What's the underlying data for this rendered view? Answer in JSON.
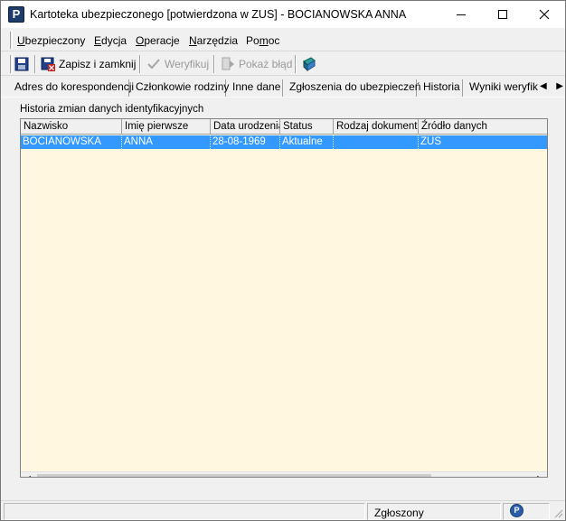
{
  "window": {
    "title": "Kartoteka ubezpieczonego [potwierdzona w ZUS] - BOCIANOWSKA ANNA",
    "app_icon_letter": "P"
  },
  "menu": {
    "items": [
      {
        "label": "Ubezpieczony",
        "accel": "U"
      },
      {
        "label": "Edycja",
        "accel": "E"
      },
      {
        "label": "Operacje",
        "accel": "O"
      },
      {
        "label": "Narzędzia",
        "accel": "N"
      },
      {
        "label": "Pomoc",
        "accel": "m"
      }
    ]
  },
  "toolbar": {
    "save_close_label": "Zapisz i zamknij",
    "verify_label": "Weryfikuj",
    "show_error_label": "Pokaż błąd"
  },
  "tabs": [
    {
      "label": "Adres do korespondencji"
    },
    {
      "label": "Członkowie rodziny"
    },
    {
      "label": "Inne dane"
    },
    {
      "label": "Zgłoszenia do ubezpieczeń"
    },
    {
      "label": "Historia"
    },
    {
      "label": "Wyniki weryfik"
    }
  ],
  "panel": {
    "group_label": "Historia zmian danych identyfikacyjnych"
  },
  "grid": {
    "columns": [
      "Nazwisko",
      "Imię pierwsze",
      "Data urodzenia",
      "Status",
      "Rodzaj dokumentu",
      "Źródło danych"
    ],
    "rows": [
      [
        "BOCIANOWSKA",
        "ANNA",
        "28-08-1969",
        "Aktualne",
        "",
        "ZUS"
      ]
    ]
  },
  "status": {
    "state_text": "Zgłoszony"
  },
  "colors": {
    "selection": "#3399ff",
    "grid_background": "#fff7df",
    "app_icon": "#1d3b6b"
  }
}
